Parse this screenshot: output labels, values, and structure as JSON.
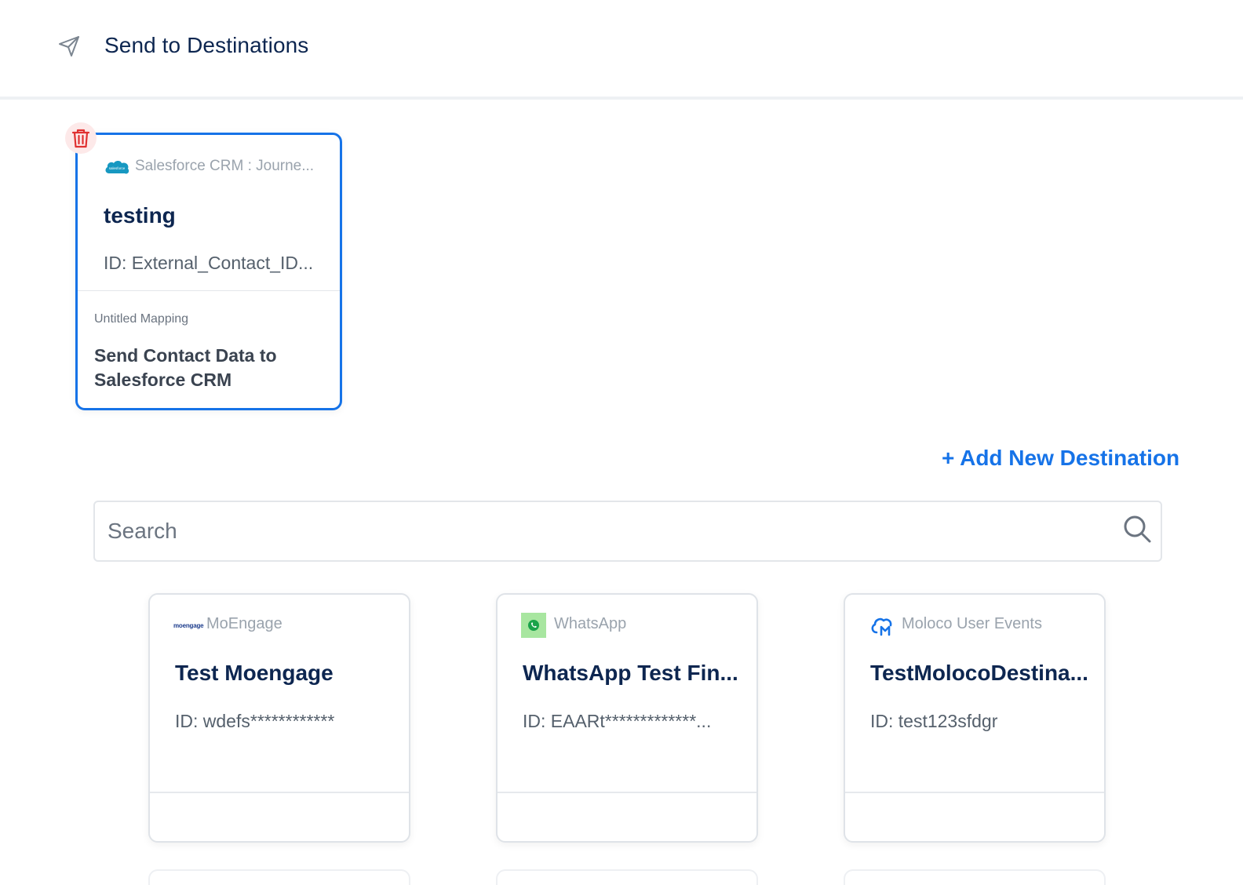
{
  "header": {
    "title": "Send to Destinations",
    "icon": "paper-plane-icon"
  },
  "selected_destination": {
    "source": "Salesforce CRM : Journe...",
    "source_logo": "salesforce-logo",
    "name": "testing",
    "id_text": "ID: External_Contact_ID...",
    "mapping_label": "Untitled Mapping",
    "mapping_name": "Send Contact Data to Salesforce CRM",
    "delete_icon": "trash-icon",
    "border_color": "#1673e8"
  },
  "add_destination_label": "+ Add New Destination",
  "search": {
    "placeholder": "Search",
    "value": ""
  },
  "destinations": [
    {
      "source": "MoEngage",
      "logo": "moengage-logo",
      "logo_text": "moengage",
      "name": "Test Moengage",
      "id_text": "ID: wdefs************"
    },
    {
      "source": "WhatsApp",
      "logo": "whatsapp-logo",
      "name": "WhatsApp Test Fin...",
      "id_text": "ID: EAARt*************..."
    },
    {
      "source": "Moloco User Events",
      "logo": "moloco-cloud-logo",
      "name": "TestMolocoDestina...",
      "id_text": "ID: test123sfdgr"
    }
  ],
  "colors": {
    "accent": "#1673e8",
    "heading": "#0d2650",
    "delete": "#e03131"
  }
}
